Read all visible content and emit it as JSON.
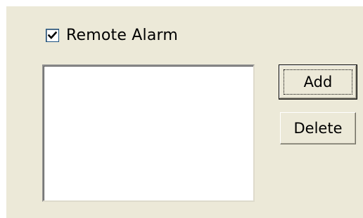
{
  "remote_alarm": {
    "label": "Remote Alarm",
    "checked": true
  },
  "list": {
    "items": []
  },
  "buttons": {
    "add_label": "Add",
    "delete_label": "Delete"
  },
  "colors": {
    "dialog_background": "#ece9d8",
    "list_background": "#ffffff"
  },
  "icons": {
    "checkbox_mark": "checkmark-icon"
  }
}
